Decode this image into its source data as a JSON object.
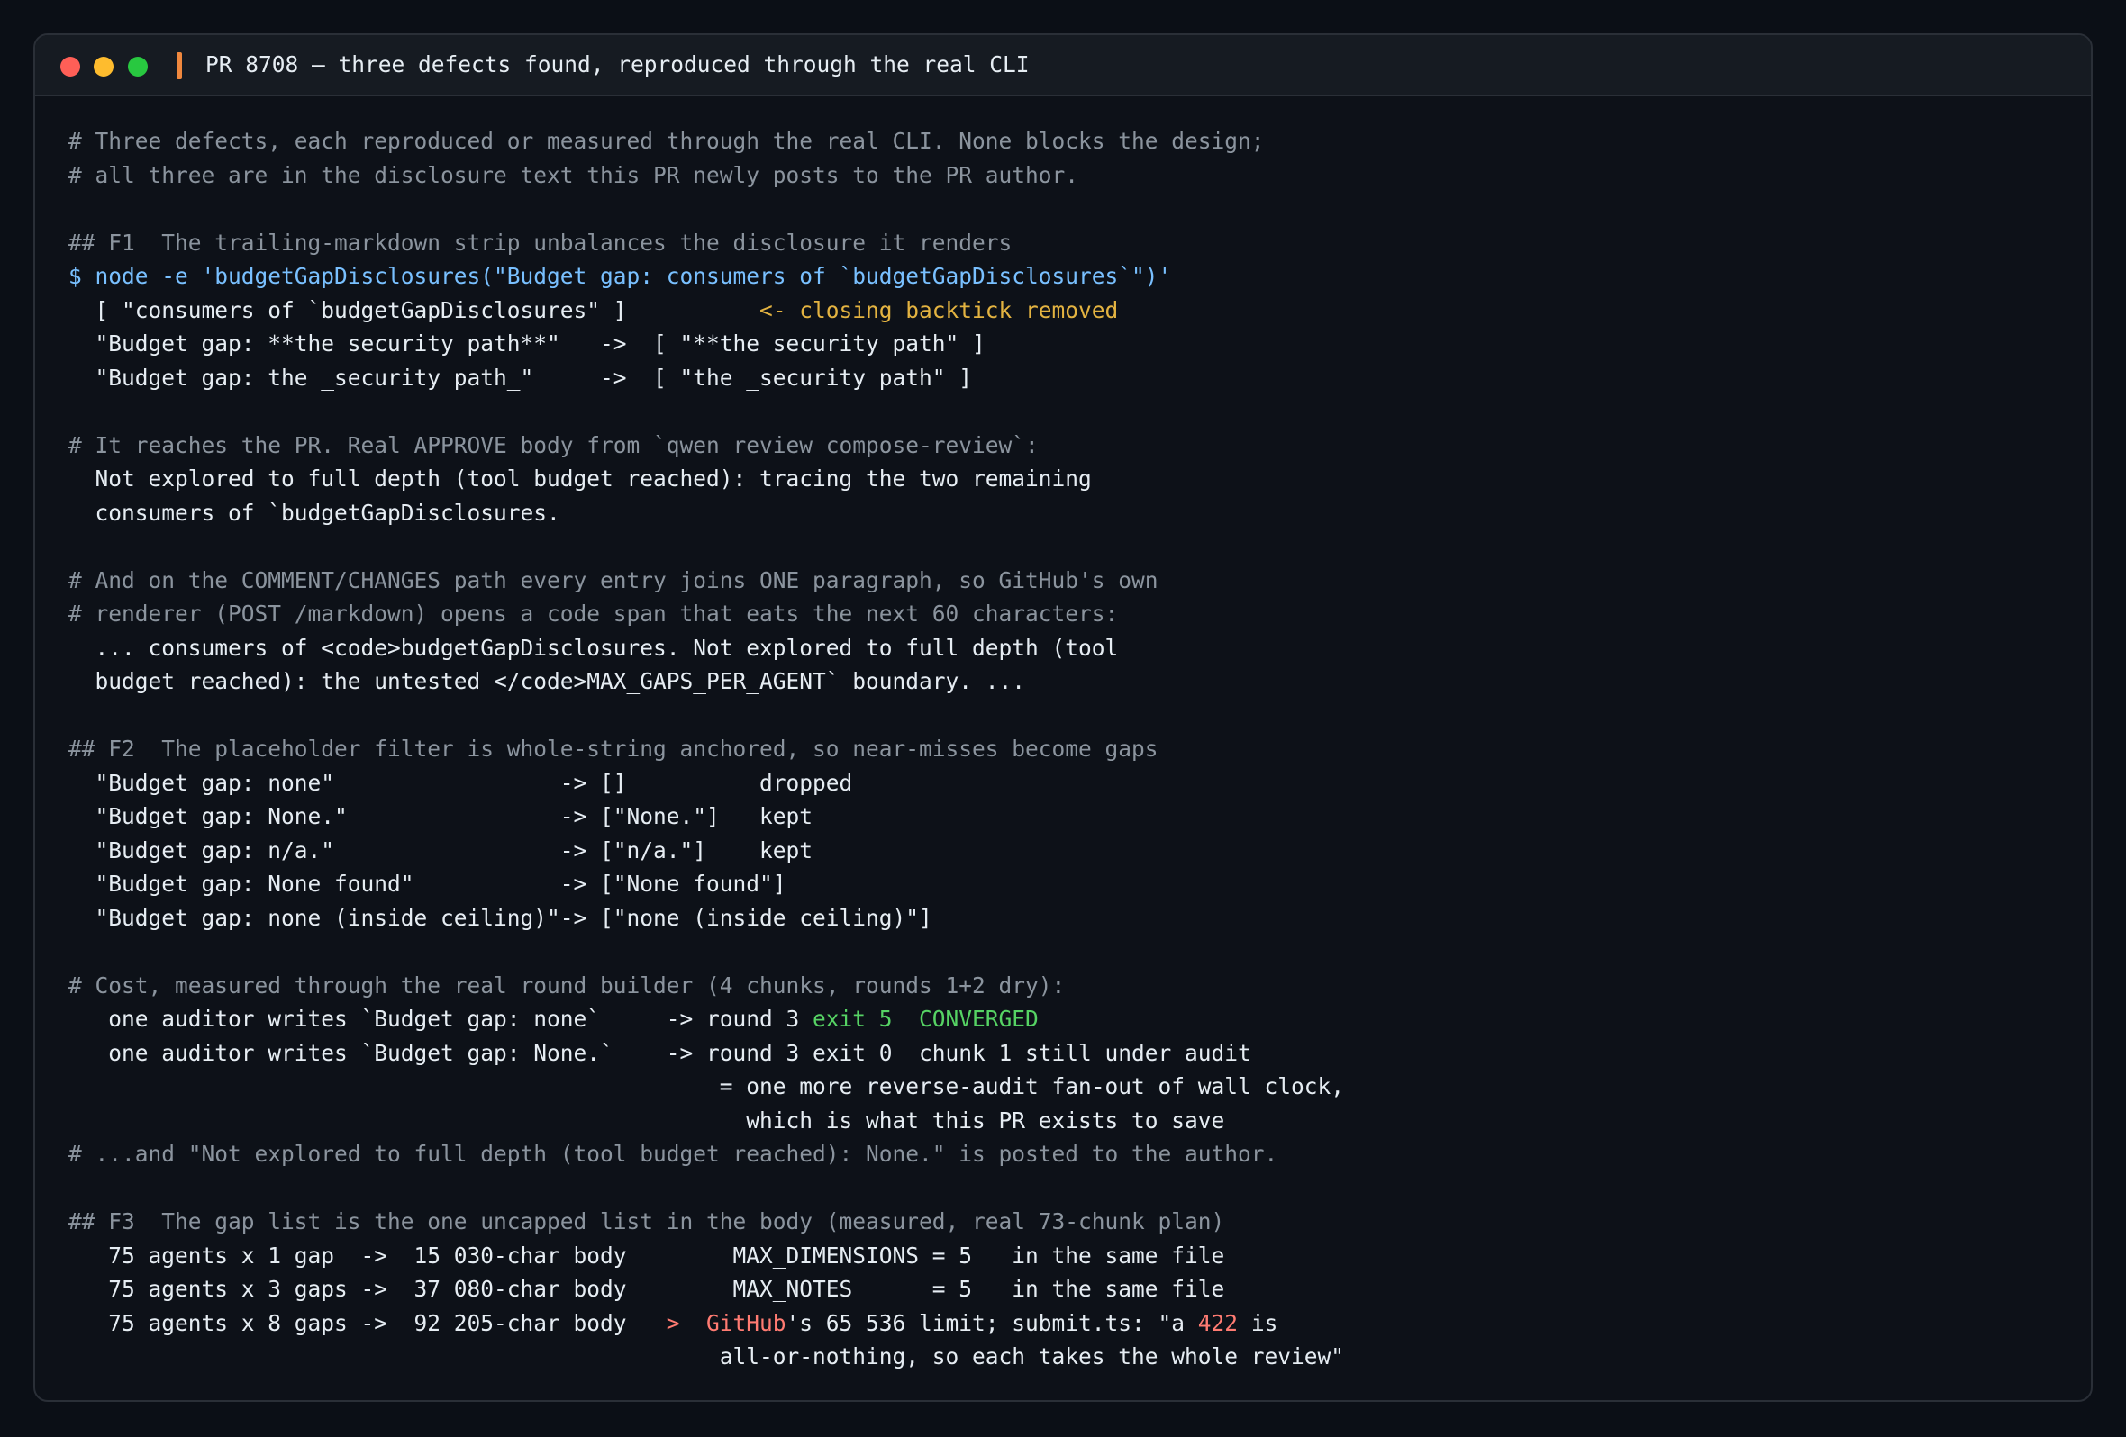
{
  "window": {
    "title": "PR 8708 — three defects found, reproduced through the real CLI"
  },
  "colors": {
    "comment": "#8b949e",
    "command": "#79c0ff",
    "output": "#e6edf3",
    "warning": "#e3b341",
    "success": "#56d364",
    "error": "#ff7b72",
    "accent": "#f0883e"
  },
  "lines": [
    {
      "segs": [
        {
          "c": "c",
          "t": "# Three defects, each reproduced or measured through the real CLI. None blocks the design;"
        }
      ]
    },
    {
      "segs": [
        {
          "c": "c",
          "t": "# all three are in the disclosure text this PR newly posts to the PR author."
        }
      ]
    },
    {
      "segs": []
    },
    {
      "segs": [
        {
          "c": "c",
          "t": "## F1  The trailing-markdown strip unbalances the disclosure it renders"
        }
      ]
    },
    {
      "segs": [
        {
          "c": "cmd",
          "t": "$ node -e 'budgetGapDisclosures(\"Budget gap: consumers of `budgetGapDisclosures`\")'"
        }
      ]
    },
    {
      "segs": [
        {
          "c": "o",
          "t": "  [ \"consumers of `budgetGapDisclosures\" ]          "
        },
        {
          "c": "warn",
          "t": "<- closing backtick removed"
        }
      ]
    },
    {
      "segs": [
        {
          "c": "o",
          "t": "  \"Budget gap: **the security path**\"   ->  [ \"**the security path\" ]"
        }
      ]
    },
    {
      "segs": [
        {
          "c": "o",
          "t": "  \"Budget gap: the _security path_\"     ->  [ \"the _security path\" ]"
        }
      ]
    },
    {
      "segs": []
    },
    {
      "segs": [
        {
          "c": "c",
          "t": "# It reaches the PR. Real APPROVE body from `qwen review compose-review`:"
        }
      ]
    },
    {
      "segs": [
        {
          "c": "o",
          "t": "  Not explored to full depth (tool budget reached): tracing the two remaining"
        }
      ]
    },
    {
      "segs": [
        {
          "c": "o",
          "t": "  consumers of `budgetGapDisclosures."
        }
      ]
    },
    {
      "segs": []
    },
    {
      "segs": [
        {
          "c": "c",
          "t": "# And on the COMMENT/CHANGES path every entry joins ONE paragraph, so GitHub's own"
        }
      ]
    },
    {
      "segs": [
        {
          "c": "c",
          "t": "# renderer (POST /markdown) opens a code span that eats the next 60 characters:"
        }
      ]
    },
    {
      "segs": [
        {
          "c": "o",
          "t": "  ... consumers of <code>budgetGapDisclosures. Not explored to full depth (tool"
        }
      ]
    },
    {
      "segs": [
        {
          "c": "o",
          "t": "  budget reached): the untested </code>MAX_GAPS_PER_AGENT` boundary. ..."
        }
      ]
    },
    {
      "segs": []
    },
    {
      "segs": [
        {
          "c": "c",
          "t": "## F2  The placeholder filter is whole-string anchored, so near-misses become gaps"
        }
      ]
    },
    {
      "segs": [
        {
          "c": "o",
          "t": "  \"Budget gap: none\"                 -> []          dropped"
        }
      ]
    },
    {
      "segs": [
        {
          "c": "o",
          "t": "  \"Budget gap: None.\"                -> [\"None.\"]   kept"
        }
      ]
    },
    {
      "segs": [
        {
          "c": "o",
          "t": "  \"Budget gap: n/a.\"                 -> [\"n/a.\"]    kept"
        }
      ]
    },
    {
      "segs": [
        {
          "c": "o",
          "t": "  \"Budget gap: None found\"           -> [\"None found\"]"
        }
      ]
    },
    {
      "segs": [
        {
          "c": "o",
          "t": "  \"Budget gap: none (inside ceiling)\"-> [\"none (inside ceiling)\"]"
        }
      ]
    },
    {
      "segs": []
    },
    {
      "segs": [
        {
          "c": "c",
          "t": "# Cost, measured through the real round builder (4 chunks, rounds 1+2 dry):"
        }
      ]
    },
    {
      "segs": [
        {
          "c": "o",
          "t": "   one auditor writes `Budget gap: none`     -> round 3 "
        },
        {
          "c": "ok",
          "t": "exit 5  CONVERGED"
        }
      ]
    },
    {
      "segs": [
        {
          "c": "o",
          "t": "   one auditor writes `Budget gap: None.`    -> round 3 exit 0  chunk 1 still under audit"
        }
      ]
    },
    {
      "segs": [
        {
          "c": "o",
          "t": "                                                 = one more reverse-audit fan-out of wall clock,"
        }
      ]
    },
    {
      "segs": [
        {
          "c": "o",
          "t": "                                                   which is what this PR exists to save"
        }
      ]
    },
    {
      "segs": [
        {
          "c": "c",
          "t": "# ...and \"Not explored to full depth (tool budget reached): None.\" is posted to the author."
        }
      ]
    },
    {
      "segs": []
    },
    {
      "segs": [
        {
          "c": "c",
          "t": "## F3  The gap list is the one uncapped list in the body (measured, real 73-chunk plan)"
        }
      ]
    },
    {
      "segs": [
        {
          "c": "o",
          "t": "   75 agents x 1 gap  ->  15 030-char body        MAX_DIMENSIONS = 5   in the same file"
        }
      ]
    },
    {
      "segs": [
        {
          "c": "o",
          "t": "   75 agents x 3 gaps ->  37 080-char body        MAX_NOTES      = 5   in the same file"
        }
      ]
    },
    {
      "segs": [
        {
          "c": "o",
          "t": "   75 agents x 8 gaps ->  92 205-char body   "
        },
        {
          "c": "err",
          "t": ">  GitHub"
        },
        {
          "c": "o",
          "t": "'s 65 536 limit; submit.ts: \"a "
        },
        {
          "c": "err",
          "t": "422"
        },
        {
          "c": "o",
          "t": " is"
        }
      ]
    },
    {
      "segs": [
        {
          "c": "o",
          "t": "                                                 all-or-nothing, so each takes the whole review\""
        }
      ]
    }
  ]
}
